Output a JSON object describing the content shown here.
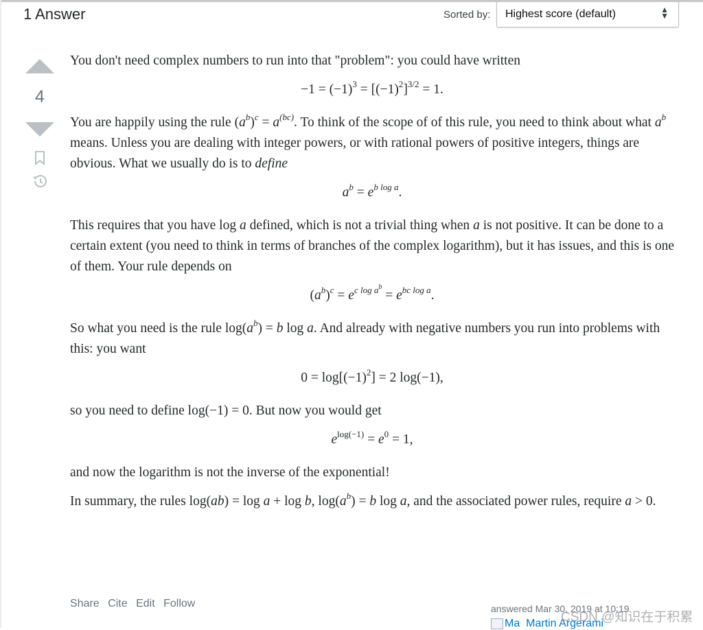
{
  "header": {
    "title": "1 Answer",
    "sort_label": "Sorted by:",
    "sort_value": "Highest score (default)"
  },
  "vote": {
    "score": "4"
  },
  "post": [
    {
      "kind": "p",
      "segs": [
        [
          "You don't need complex numbers to run into that \"problem\": you could have written",
          ""
        ]
      ]
    },
    {
      "kind": "disp",
      "segs": [
        [
          "−1 = (−1)",
          ""
        ],
        [
          "3",
          "sup"
        ],
        [
          " = [(−1)",
          ""
        ],
        [
          "2",
          "sup"
        ],
        [
          "]",
          ""
        ],
        [
          "3/2",
          "sup"
        ],
        [
          " = 1.",
          ""
        ]
      ]
    },
    {
      "kind": "p",
      "segs": [
        [
          "You are happily using the rule (",
          ""
        ],
        [
          "a",
          "i"
        ],
        [
          "b",
          "isup"
        ],
        [
          ")",
          ""
        ],
        [
          "c",
          "isup"
        ],
        [
          " = ",
          ""
        ],
        [
          "a",
          "i"
        ],
        [
          "(bc)",
          "isup"
        ],
        [
          ". To think of the scope of of this rule, you need to think about what ",
          ""
        ],
        [
          "a",
          "i"
        ],
        [
          "b",
          "isup"
        ],
        [
          " means. Unless you are dealing with integer powers, or with rational powers of positive integers, things are obvious. What we usually do is to ",
          ""
        ],
        [
          "define",
          "i"
        ]
      ]
    },
    {
      "kind": "disp",
      "segs": [
        [
          "a",
          "i"
        ],
        [
          "b",
          "isup"
        ],
        [
          " = ",
          ""
        ],
        [
          "e",
          "i"
        ],
        [
          "b log a",
          "isup"
        ],
        [
          ".",
          ""
        ]
      ]
    },
    {
      "kind": "p",
      "segs": [
        [
          "This requires that you have log ",
          ""
        ],
        [
          "a",
          "i"
        ],
        [
          " defined, which is not a trivial thing when ",
          ""
        ],
        [
          "a",
          "i"
        ],
        [
          " is not positive. It can be done to a certain extent (you need to think in terms of branches of the complex logarithm), but it has issues, and this is one of them. Your rule depends on",
          ""
        ]
      ]
    },
    {
      "kind": "disp",
      "segs": [
        [
          "(",
          ""
        ],
        [
          "a",
          "i"
        ],
        [
          "b",
          "isup"
        ],
        [
          ")",
          ""
        ],
        [
          "c",
          "isup"
        ],
        [
          " = ",
          ""
        ],
        [
          "e",
          "i"
        ],
        [
          "c log a",
          "isup"
        ],
        [
          "b",
          "sup2"
        ],
        [
          " = ",
          ""
        ],
        [
          "e",
          "i"
        ],
        [
          "bc log a",
          "isup"
        ],
        [
          ".",
          ""
        ]
      ]
    },
    {
      "kind": "p",
      "segs": [
        [
          "So what you need is the rule log(",
          ""
        ],
        [
          "a",
          "i"
        ],
        [
          "b",
          "isup"
        ],
        [
          ") = ",
          ""
        ],
        [
          "b",
          "i"
        ],
        [
          " log ",
          ""
        ],
        [
          "a",
          "i"
        ],
        [
          ". And already with negative numbers you run into problems with this: you want",
          ""
        ]
      ]
    },
    {
      "kind": "disp",
      "segs": [
        [
          "0 = log[(−1)",
          ""
        ],
        [
          "2",
          "sup"
        ],
        [
          "] = 2 log(−1),",
          ""
        ]
      ]
    },
    {
      "kind": "p",
      "segs": [
        [
          "so you need to define log(−1) = 0. But now you would get",
          ""
        ]
      ]
    },
    {
      "kind": "disp",
      "segs": [
        [
          "e",
          "i"
        ],
        [
          "log(−1)",
          "sup"
        ],
        [
          " = ",
          ""
        ],
        [
          "e",
          "i"
        ],
        [
          "0",
          "sup"
        ],
        [
          " = 1,",
          ""
        ]
      ]
    },
    {
      "kind": "p",
      "segs": [
        [
          "and now the logarithm is not the inverse of the exponential!",
          ""
        ]
      ]
    },
    {
      "kind": "p",
      "segs": [
        [
          "In summary, the rules log(",
          ""
        ],
        [
          "ab",
          "i"
        ],
        [
          ") = log ",
          ""
        ],
        [
          "a",
          "i"
        ],
        [
          " + log ",
          ""
        ],
        [
          "b",
          "i"
        ],
        [
          ", log(",
          ""
        ],
        [
          "a",
          "i"
        ],
        [
          "b",
          "isup"
        ],
        [
          ") = ",
          ""
        ],
        [
          "b",
          "i"
        ],
        [
          " log ",
          ""
        ],
        [
          "a",
          "i"
        ],
        [
          ", and the associated power rules, require ",
          ""
        ],
        [
          "a",
          "i"
        ],
        [
          " > 0.",
          ""
        ]
      ]
    }
  ],
  "footer": {
    "links": [
      "Share",
      "Cite",
      "Edit",
      "Follow"
    ],
    "answered": "answered Mar 30, 2019 at 10:19",
    "author_img_alt": "Ma",
    "author": "Martin Argerami"
  },
  "watermark": "CSDN @知识在于积累",
  "icons": {
    "up": "upvote-arrow-icon",
    "down": "downvote-arrow-icon",
    "bookmark": "bookmark-icon",
    "history": "history-icon",
    "sort": "sort-chevrons-icon"
  }
}
